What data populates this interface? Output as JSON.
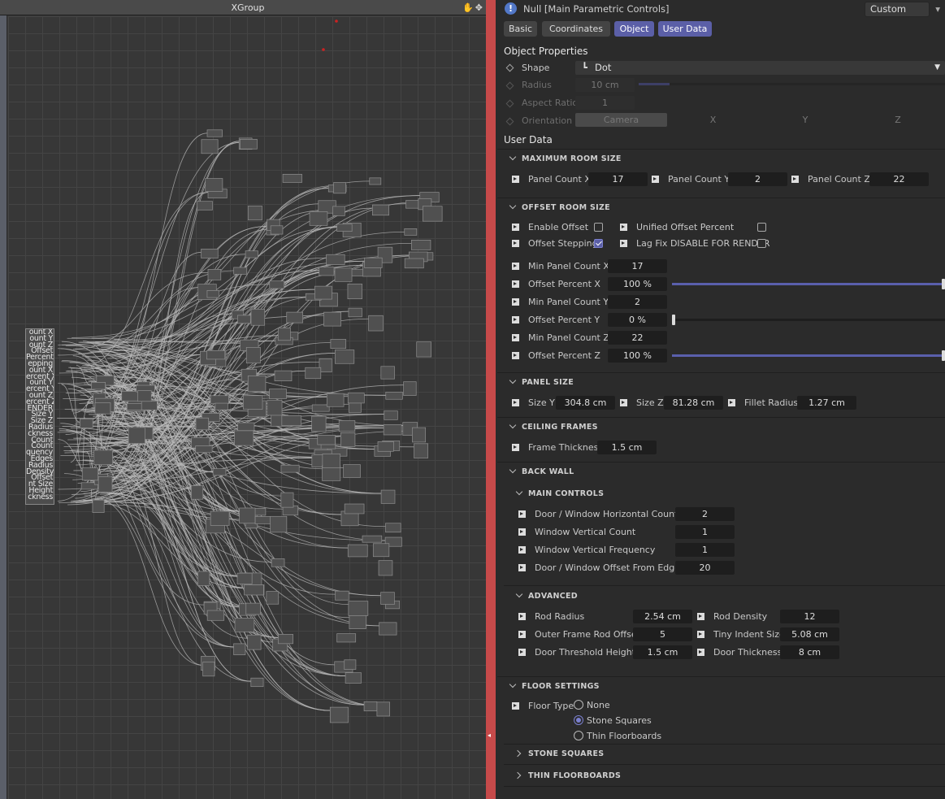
{
  "xpresso": {
    "title": "XGroup",
    "input_ports": [
      "ount X",
      "ount Y",
      "ount Z",
      "Offset",
      "Percent",
      "epping",
      "ount X",
      "ercent X",
      "ount Y",
      "ercent Y",
      "ount Z",
      "ercent Z",
      "ENDER",
      "Size Y",
      "Size Z",
      "Radius",
      "ckness",
      "Count",
      "Count",
      "quency",
      "Edges",
      "Radius",
      "Density",
      "Offset",
      "nt Size",
      "Height",
      "ckness"
    ]
  },
  "header": {
    "object_title": "Null [Main Parametric Controls]",
    "mode_dropdown": "Custom",
    "tabs": [
      "Basic",
      "Coordinates",
      "Object",
      "User Data"
    ],
    "active_tab": "Object"
  },
  "object_properties": {
    "title": "Object Properties",
    "shape_label": "Shape",
    "shape_value": "Dot",
    "radius_label": "Radius",
    "radius_value": "10 cm",
    "aspect_label": "Aspect Ratio",
    "aspect_value": "1",
    "orientation_label": "Orientation",
    "orientation_options": [
      "Camera",
      "X",
      "Y",
      "Z"
    ]
  },
  "user_data": {
    "title": "User Data",
    "max_room": {
      "title": "MAXIMUM ROOM SIZE",
      "px_label": "Panel Count X",
      "px_value": "17",
      "py_label": "Panel Count Y",
      "py_value": "2",
      "pz_label": "Panel Count  Z",
      "pz_value": "22"
    },
    "offset_room": {
      "title": "OFFSET ROOM SIZE",
      "enable_offset": "Enable Offset",
      "unified": "Unified Offset Percent",
      "stepping": "Offset Stepping",
      "lagfix": "Lag Fix DISABLE FOR RENDER",
      "rows": [
        {
          "label": "Min Panel Count  X",
          "value": "17"
        },
        {
          "label": "Offset Percent X",
          "value": "100 %",
          "slider": 1.0
        },
        {
          "label": "Min Panel Count Y",
          "value": "2"
        },
        {
          "label": "Offset Percent Y",
          "value": "0 %",
          "slider": 0.0
        },
        {
          "label": "Min Panel Count Z",
          "value": "22"
        },
        {
          "label": "Offset Percent Z",
          "value": "100 %",
          "slider": 1.0
        }
      ]
    },
    "panel_size": {
      "title": "PANEL SIZE",
      "y_label": "Size Y",
      "y_value": "304.8 cm",
      "z_label": "Size Z",
      "z_value": "81.28 cm",
      "fillet_label": "Fillet Radius",
      "fillet_value": "1.27 cm"
    },
    "ceiling": {
      "title": "CEILING FRAMES",
      "frame_label": "Frame Thickness",
      "frame_value": "1.5 cm"
    },
    "back_wall": {
      "title": "BACK WALL",
      "main_title": "MAIN CONTROLS",
      "main_rows": [
        {
          "label": "Door / Window Horizontal Count",
          "value": "2"
        },
        {
          "label": "Window Vertical Count",
          "value": "1"
        },
        {
          "label": "Window Vertical Frequency",
          "value": "1"
        },
        {
          "label": "Door / Window Offset From Edges",
          "value": "20"
        }
      ],
      "advanced_title": "ADVANCED",
      "adv_left": [
        {
          "label": "Rod Radius",
          "value": "2.54 cm"
        },
        {
          "label": "Outer Frame Rod Offset",
          "value": "5"
        },
        {
          "label": "Door Threshold Height",
          "value": "1.5 cm"
        }
      ],
      "adv_right": [
        {
          "label": "Rod Density",
          "value": "12"
        },
        {
          "label": "Tiny Indent Size",
          "value": "5.08 cm"
        },
        {
          "label": "Door Thickness",
          "value": "8 cm"
        }
      ]
    },
    "floor": {
      "title": "FLOOR SETTINGS",
      "type_label": "Floor Type",
      "options": [
        "None",
        "Stone Squares",
        "Thin Floorboards"
      ],
      "selected": "Stone Squares",
      "stone_title": "STONE SQUARES",
      "thin_title": "THIN FLOORBOARDS"
    }
  },
  "colors": {
    "accent": "#5b5fa7",
    "field_bg": "#1e1e1e",
    "panel_bg": "#2b2b2b",
    "graph_bg": "#373737",
    "marker": "#cc2222"
  }
}
